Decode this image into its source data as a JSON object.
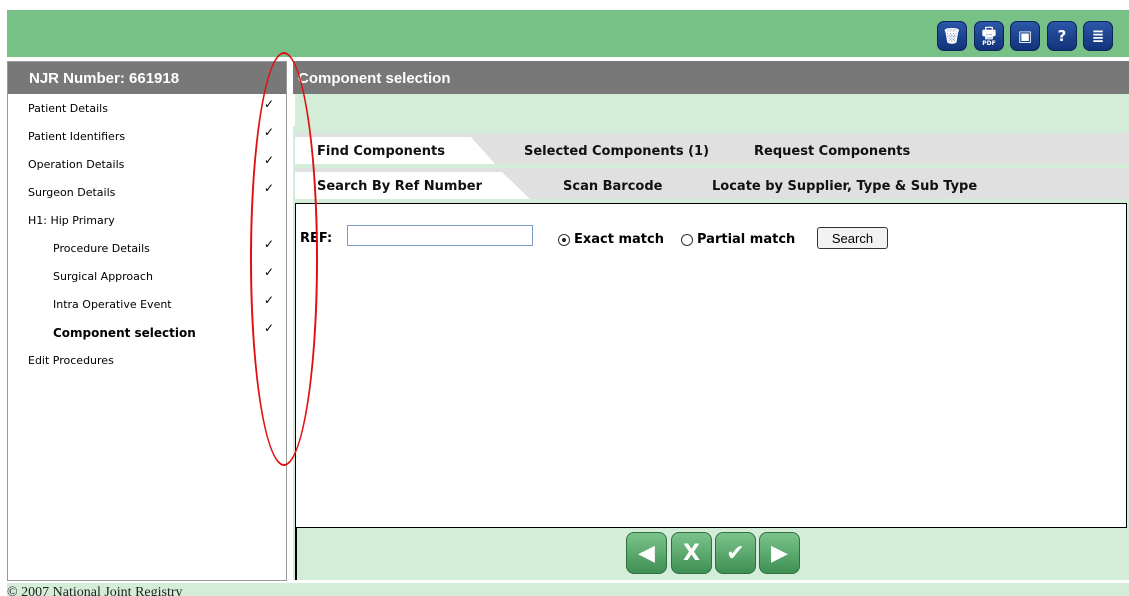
{
  "toolbar": {
    "buttons": [
      {
        "icon": "trash-icon",
        "glyph": "🗑"
      },
      {
        "icon": "pdf-print-icon",
        "glyph": "🖶",
        "sub": "PDF"
      },
      {
        "icon": "save-icon",
        "glyph": "▣"
      },
      {
        "icon": "help-icon",
        "glyph": "?"
      },
      {
        "icon": "notes-icon",
        "glyph": "≣"
      }
    ]
  },
  "sidebar": {
    "title": "NJR Number: 661918",
    "items": [
      {
        "label": "Patient Details",
        "checked": true
      },
      {
        "label": "Patient Identifiers",
        "checked": true
      },
      {
        "label": "Operation Details",
        "checked": true
      },
      {
        "label": "Surgeon Details",
        "checked": true
      },
      {
        "label": "H1: Hip Primary",
        "checked": false
      },
      {
        "label": "Procedure Details",
        "checked": true
      },
      {
        "label": "Surgical Approach",
        "checked": true
      },
      {
        "label": "Intra Operative Event",
        "checked": true
      },
      {
        "label": "Component selection",
        "checked": true
      },
      {
        "label": "Edit Procedures",
        "checked": false
      }
    ],
    "check_glyph": "✓"
  },
  "main": {
    "title": "Component selection",
    "tabs1": [
      "Find Components",
      "Selected Components (1)",
      "Request Components"
    ],
    "tabs2": [
      "Search By Ref Number",
      "Scan Barcode",
      "Locate by Supplier, Type & Sub Type"
    ],
    "ref_label": "REF:",
    "ref_value": "",
    "exact_label": "Exact match",
    "partial_label": "Partial match",
    "search_label": "Search"
  },
  "nav": {
    "prev": "◀",
    "cancel": "X",
    "confirm": "✔",
    "next": "▶"
  },
  "footer": {
    "text": "© 2007 National Joint Registry"
  },
  "colors": {
    "top_bar": "#77c186",
    "header_gray": "#787878",
    "panel_green": "#d4edd9",
    "annotation_red": "#e01010"
  }
}
